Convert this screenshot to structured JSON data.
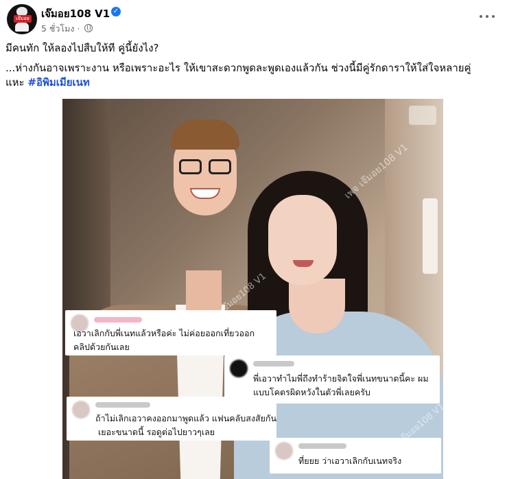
{
  "post": {
    "page_name": "เจ๊มอย108 V1",
    "time": "5 ชั่วโมง ·",
    "line1": "มีคนทัก ให้ลองไปสืบให้ที คู่นี้ยังไง?",
    "line2": "...ห่างกันอาจเพราะงาน หรือเพราะอะไร ให้เขาสะดวกพูดละพูดเองแล้วกัน ช่วงนี้มีคู่รักดาราให้ใส่ใจหลายคู่",
    "line3_prefix": "แหะ ",
    "hashtag": "#อิพิมเมียเนท"
  },
  "avatar": {
    "badge_text": "เจ๊มอย"
  },
  "icons": {
    "verified": "verified-badge-icon",
    "privacy": "globe-icon",
    "more": "more-options-icon"
  },
  "photo": {
    "watermark": "เพจ เจ๊มอย108 V1",
    "comments": [
      {
        "text1": "เอวาเลิกกับพี่เนทแล้วหรือค่ะ ไม่ค่อยออกเที่ยวออก",
        "text2": "คลิปด้วยกันเลย"
      },
      {
        "text1": "พี่เอวาทำไมพี่ถึงทำร้ายจิตใจพี่เนทขนาดนี้คะ ผม",
        "text2": "แบบโคตรผิดหวังในตัวพี่เลยครับ"
      },
      {
        "text1": "ถ้าไม่เลิกเอวาคงออกมาพูดแล้ว แฟนคลับสงสัยกัน",
        "text2": "เยอะขนาดนี้ รอดูต่อไปยาวๆเลย"
      },
      {
        "text1": "ที่ยยย ว่าเอวาเลิกกับเนทจริง"
      }
    ]
  },
  "colors": {
    "accent": "#1877f2",
    "hashtag": "#1b4fd8",
    "muted": "#65676b"
  }
}
